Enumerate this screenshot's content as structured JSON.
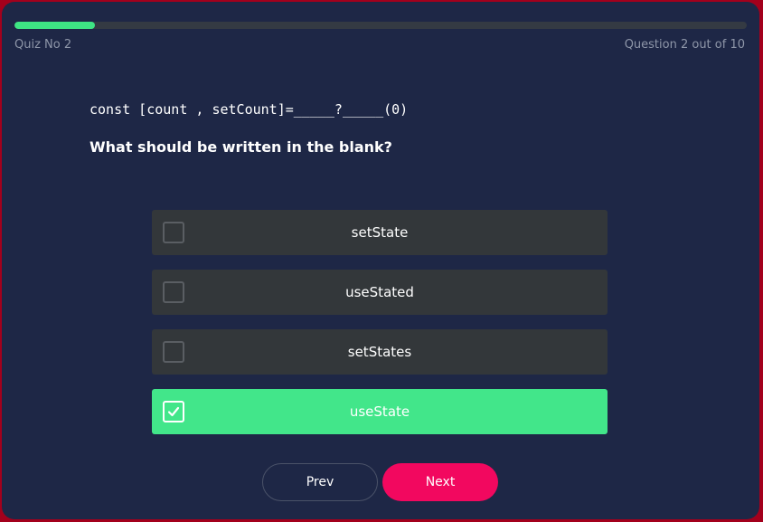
{
  "header": {
    "quiz_name": "Quiz No 2",
    "question_counter": "Question 2 out of 10",
    "progress_fraction": 0.11
  },
  "question": {
    "code": "const [count , setCount]=_____?_____(0)",
    "prompt": "What should be written in the blank?"
  },
  "options": [
    {
      "label": "setState",
      "selected": false
    },
    {
      "label": "useStated",
      "selected": false
    },
    {
      "label": "setStates",
      "selected": false
    },
    {
      "label": "useState",
      "selected": true
    }
  ],
  "nav": {
    "prev_label": "Prev",
    "next_label": "Next"
  },
  "colors": {
    "background": "#1e2746",
    "accent_green": "#42e68a",
    "next_pink": "#f2085f",
    "option_bg": "#33373a"
  },
  "icons": {
    "selected_check": "check-icon"
  }
}
